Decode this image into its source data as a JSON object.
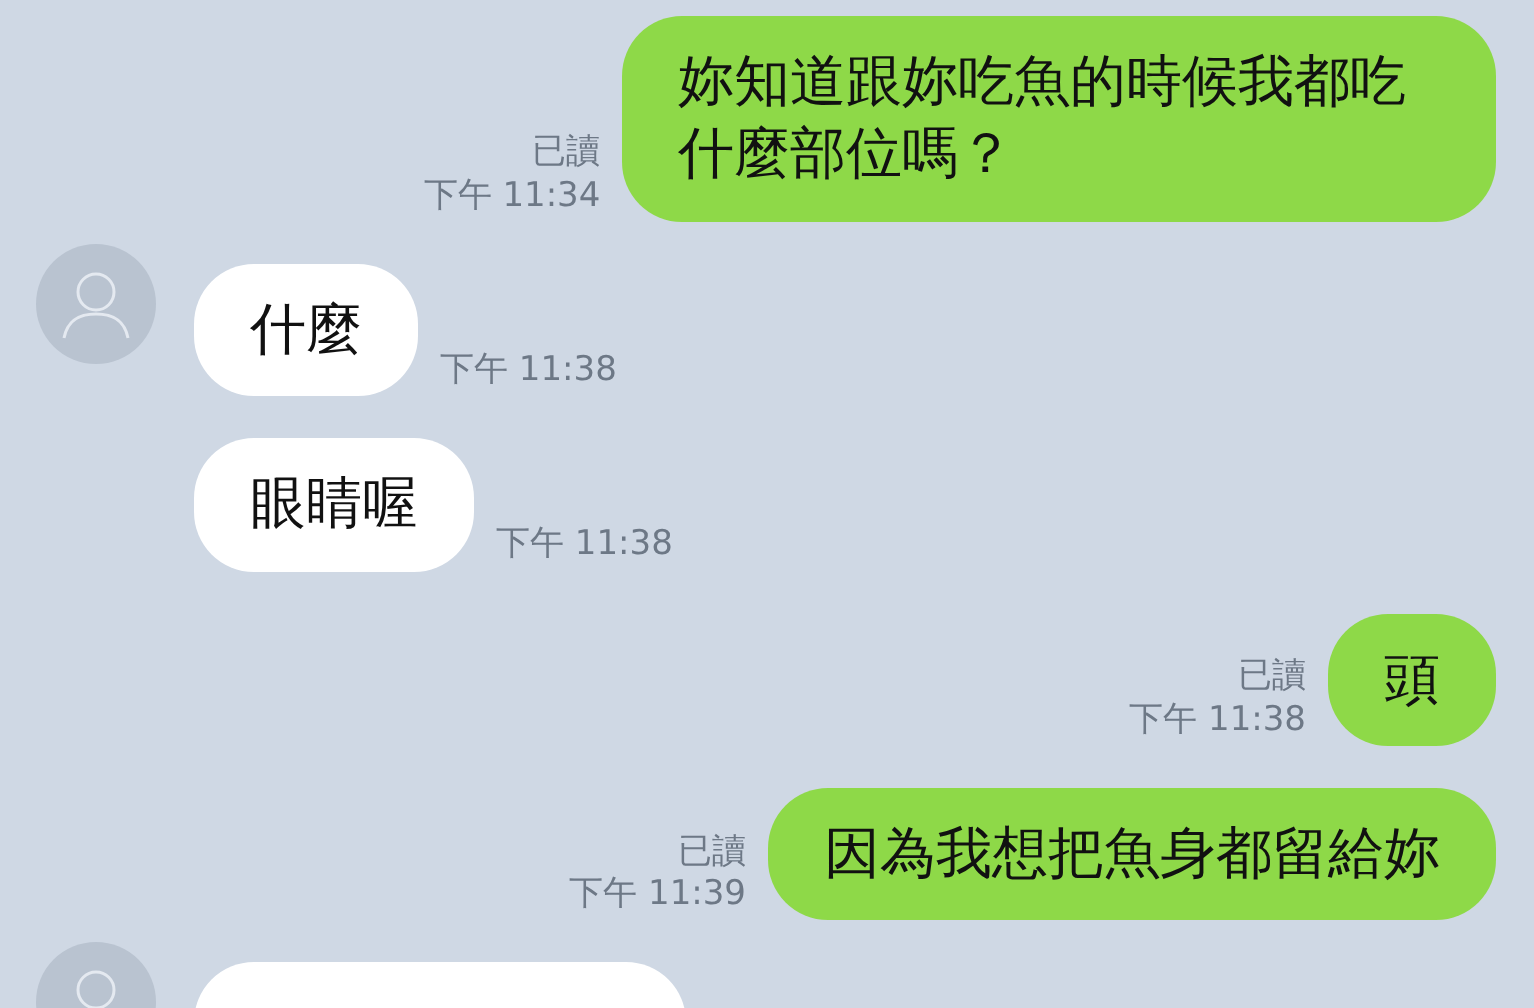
{
  "messages": [
    {
      "kind": "sent",
      "text": "妳知道跟妳吃魚的時候我都吃什麼部位嗎？",
      "read_label": "已讀",
      "time": "下午 11:34"
    },
    {
      "kind": "received",
      "avatar": true,
      "text": "什麼",
      "time": "下午 11:38"
    },
    {
      "kind": "received",
      "avatar": false,
      "text": "眼睛喔",
      "time": "下午 11:38"
    },
    {
      "kind": "sent",
      "text": "頭",
      "read_label": "已讀",
      "time": "下午 11:38"
    },
    {
      "kind": "sent",
      "text": "因為我想把魚身都留給妳",
      "read_label": "已讀",
      "time": "下午 11:39"
    },
    {
      "kind": "received",
      "avatar": true
    }
  ]
}
